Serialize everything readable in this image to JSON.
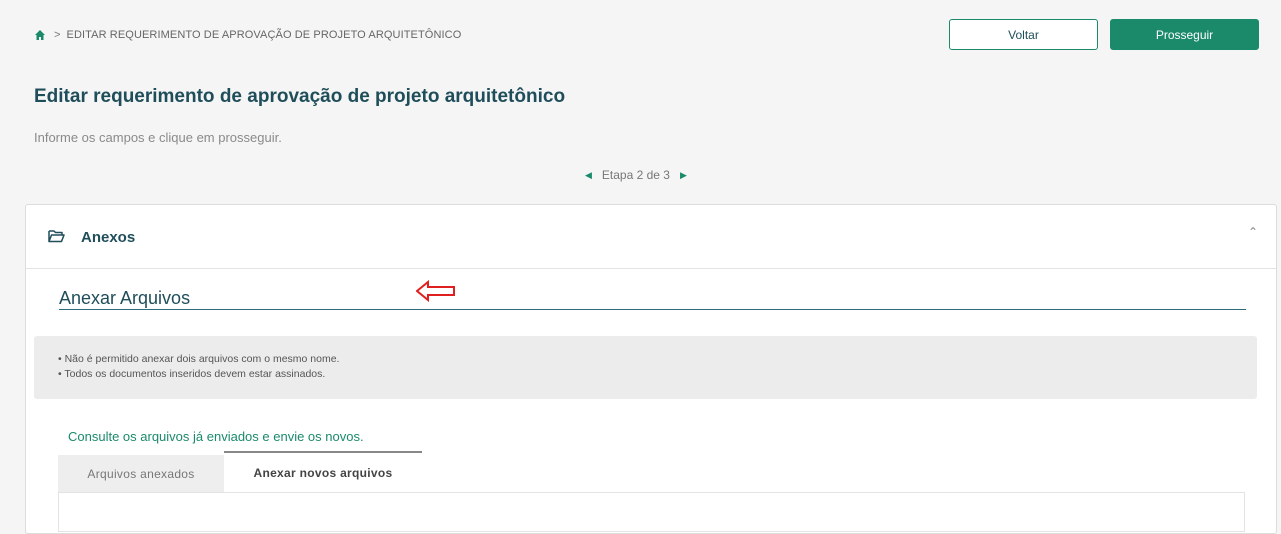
{
  "breadcrumb": {
    "separator": ">",
    "current": "EDITAR REQUERIMENTO DE APROVAÇÃO DE PROJETO ARQUITETÔNICO"
  },
  "actions": {
    "back_label": "Voltar",
    "next_label": "Prosseguir"
  },
  "page": {
    "title": "Editar requerimento de aprovação de projeto arquitetônico",
    "subtitle": "Informe os campos e clique em prosseguir."
  },
  "stepper": {
    "label": "Etapa 2 de 3",
    "current": 2,
    "total": 3
  },
  "panel": {
    "title": "Anexos",
    "section_title": "Anexar Arquivos",
    "notices": [
      "• Não é permitido anexar dois arquivos com o mesmo nome.",
      "• Todos os documentos inseridos devem estar assinados."
    ],
    "consult_text": "Consulte os arquivos já enviados e envie os novos.",
    "tabs": [
      {
        "label": "Arquivos anexados",
        "active": false
      },
      {
        "label": "Anexar novos arquivos",
        "active": true
      }
    ]
  },
  "colors": {
    "primary": "#1b8a6b",
    "title": "#1f4e5a",
    "annotation": "#e02020"
  },
  "icons": [
    "home-icon",
    "folder-open-icon",
    "chevron-up-icon",
    "caret-left-icon",
    "caret-right-icon",
    "left-arrow-annotation-icon"
  ]
}
